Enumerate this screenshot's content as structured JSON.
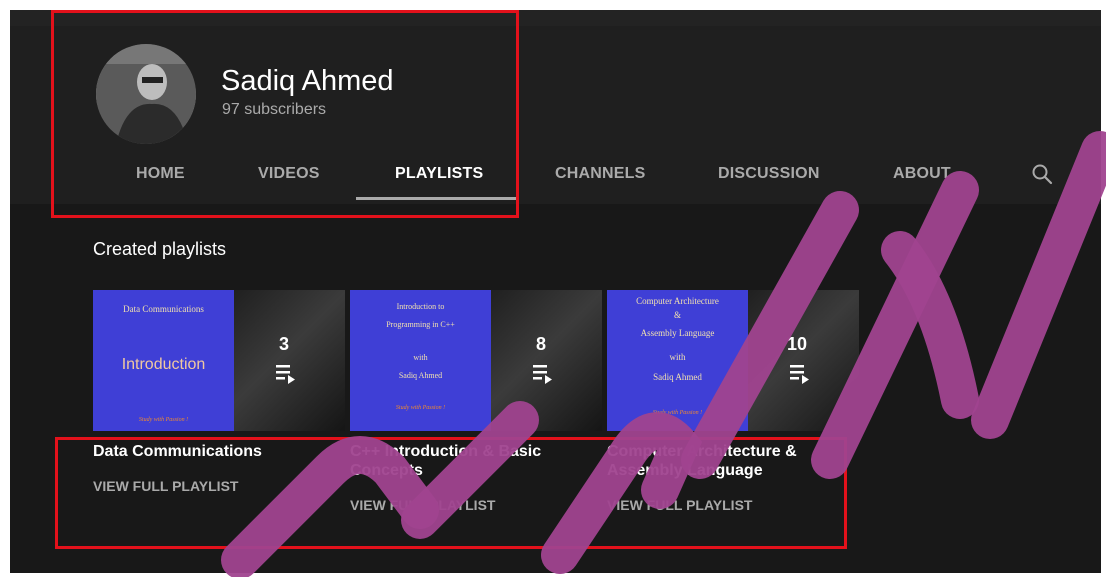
{
  "channel": {
    "name": "Sadiq Ahmed",
    "subscribers": "97 subscribers"
  },
  "tabs": [
    {
      "label": "HOME"
    },
    {
      "label": "VIDEOS"
    },
    {
      "label": "PLAYLISTS",
      "active": true
    },
    {
      "label": "CHANNELS"
    },
    {
      "label": "DISCUSSION"
    },
    {
      "label": "ABOUT"
    }
  ],
  "section": {
    "title": "Created playlists"
  },
  "playlists": [
    {
      "count": "3",
      "title": "Data Communications",
      "link": "VIEW FULL PLAYLIST",
      "slide": [
        "Data Communications",
        "Introduction",
        "Study with Passion !"
      ]
    },
    {
      "count": "8",
      "title": "C++ Introduction & Basic Concepts",
      "link": "VIEW FULL PLAYLIST",
      "slide": [
        "Introduction to",
        "Programming in C++",
        "with",
        "Sadiq Ahmed",
        "Study with Passion !"
      ]
    },
    {
      "count": "10",
      "title": "Computer Architecture & Assembly Language",
      "link": "VIEW FULL PLAYLIST",
      "slide": [
        "Computer Architecture",
        "&",
        "Assembly Language",
        "with",
        "Sadiq Ahmed",
        "Study with Passion !"
      ]
    }
  ],
  "icons": {
    "search": "search-icon",
    "playlist": "playlist-play-icon"
  },
  "colors": {
    "accent": "#e3111b",
    "watermark": "#a0438f",
    "background": "#181818"
  }
}
